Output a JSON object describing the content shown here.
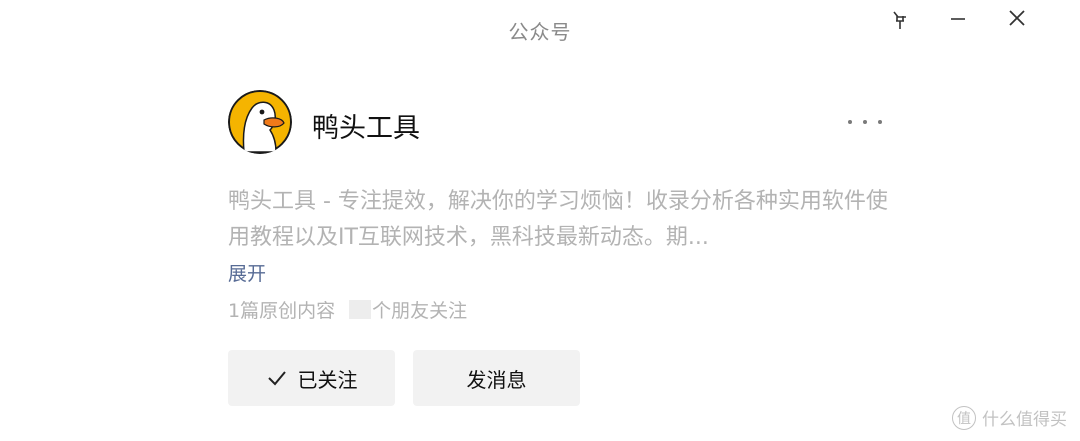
{
  "window": {
    "title": "公众号"
  },
  "profile": {
    "name": "鸭头工具",
    "description": "鸭头工具 - 专注提效，解决你的学习烦恼！收录分析各种实用软件使用教程以及IT互联网技术，黑科技最新动态。期...",
    "expand_label": "展开",
    "articles_count": "1篇原创内容",
    "friends_suffix": "个朋友关注"
  },
  "actions": {
    "follow_label": "已关注",
    "message_label": "发消息"
  },
  "watermark": {
    "badge": "值",
    "text": "什么值得买"
  },
  "colors": {
    "link": "#576b95",
    "muted_text": "#b3b3b3",
    "avatar_bg": "#f5b400"
  }
}
